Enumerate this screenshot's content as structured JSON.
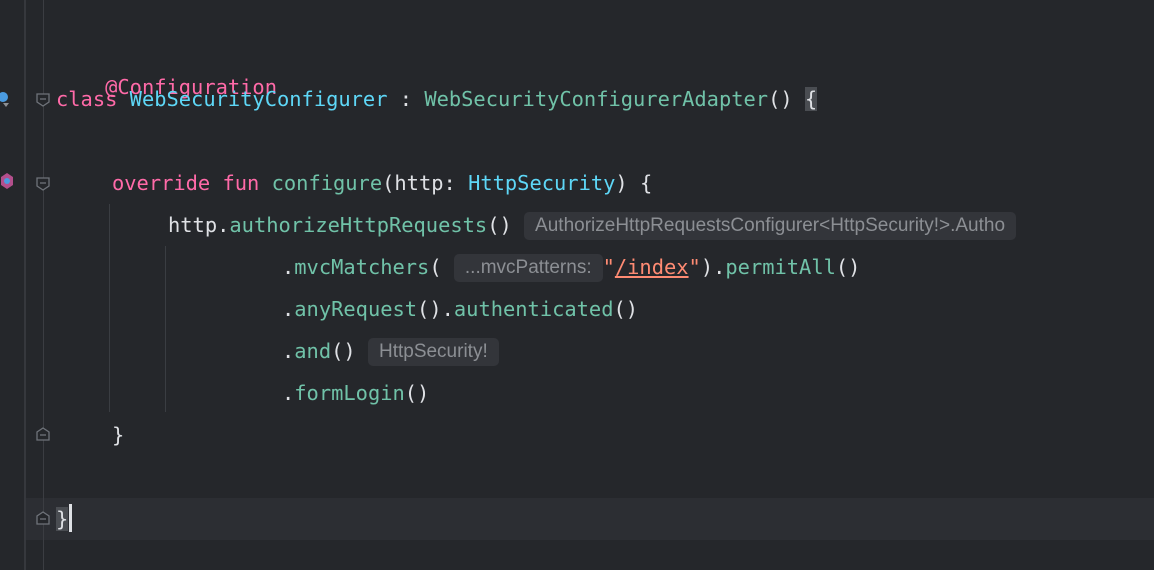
{
  "editor": {
    "language": "kotlin",
    "lines": {
      "annotation": "@Configuration",
      "class_kw": "class",
      "class_name": "WebSecurityConfigurer",
      "colon": " : ",
      "superclass": "WebSecurityConfigurerAdapter",
      "superclass_call": "()",
      "open_brace": "{",
      "override_kw": "override",
      "fun_kw": "fun",
      "fn_name": "configure",
      "paren_open": "(",
      "param": "http: ",
      "param_type": "HttpSecurity",
      "fn_sig_close": ") {",
      "http_recv": "http.",
      "authorize_call": "authorizeHttpRequests",
      "authorize_parens": "()",
      "authorize_hint": "AuthorizeHttpRequestsConfigurer<HttpSecurity!>.Autho",
      "dot1": ".",
      "mvc_call": "mvcMatchers",
      "mvc_open": "(",
      "mvc_hint": "...mvcPatterns:",
      "quote_open": "\"",
      "mvc_path": "/index",
      "quote_close": "\"",
      "mvc_close_dot": ").",
      "permit_call": "permitAll",
      "permit_parens": "()",
      "dot2": ".",
      "any_call": "anyRequest",
      "any_close_dot": "().",
      "authenticated_call": "authenticated",
      "authenticated_parens": "()",
      "dot3": ".",
      "and_call": "and",
      "and_parens": "()",
      "and_hint": "HttpSecurity!",
      "dot4": ".",
      "form_call": "formLogin",
      "form_parens": "()",
      "fn_close_brace": "}",
      "class_close_brace": "}"
    }
  },
  "colors": {
    "background": "#25272b",
    "keyword": "#ff6aa8",
    "class_name": "#5ed7f7",
    "function_call": "#70c2a8",
    "string": "#ff8b73",
    "plain": "#dfe1e5",
    "inlay_hint": "#8c8f94"
  },
  "icons": {
    "fold": "fold-arrow-icon",
    "implemented": "implemented-marker-icon",
    "override": "override-marker-icon"
  }
}
